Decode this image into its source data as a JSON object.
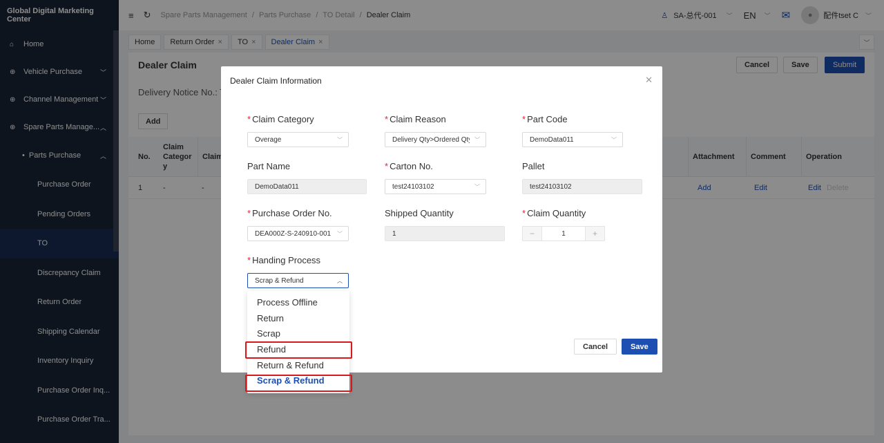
{
  "app": {
    "title": "Global Digital Marketing Center"
  },
  "sidebar": {
    "items": [
      {
        "label": "Home",
        "icon": "home-icon"
      },
      {
        "label": "Vehicle Purchase",
        "icon": "circle-plus-icon"
      },
      {
        "label": "Channel Management",
        "icon": "circle-plus-icon"
      },
      {
        "label": "Spare Parts Manage...",
        "icon": "circle-plus-icon"
      }
    ],
    "sub_parent": "Parts Purchase",
    "sub_items": [
      "Purchase Order",
      "Pending Orders",
      "TO",
      "Discrepancy Claim",
      "Return Order",
      "Shipping Calendar",
      "Inventory Inquiry",
      "Purchase Order Inq...",
      "Purchase Order Tra..."
    ],
    "active_sub": "TO"
  },
  "topbar": {
    "breadcrumb": [
      "Spare Parts Management",
      "/",
      "Parts Purchase",
      "/",
      "TO Detail",
      "/",
      "Dealer Claim"
    ],
    "org": "SA-总代-001",
    "lang": "EN",
    "user": "配件tset C"
  },
  "tabs": [
    "Home",
    "Return Order",
    "TO",
    "Dealer Claim"
  ],
  "page": {
    "title": "Dealer Claim",
    "cancel": "Cancel",
    "save": "Save",
    "submit": "Submit",
    "notice": "Delivery Notice No.: T",
    "add": "Add",
    "columns": {
      "no": "No.",
      "claim_category": "Claim Categor y",
      "claim": "Claim",
      "attachment": "Attachment",
      "comment": "Comment",
      "operation": "Operation"
    },
    "row": {
      "no": "1",
      "c1": "-",
      "c2": "-",
      "attachment": "Add",
      "comment": "Edit",
      "op_edit": "Edit",
      "op_delete": "Delete"
    }
  },
  "modal": {
    "title": "Dealer Claim Information",
    "fields": {
      "claim_category": {
        "label": "Claim Category",
        "value": "Overage"
      },
      "claim_reason": {
        "label": "Claim Reason",
        "value": "Delivery Qty>Ordered Qty"
      },
      "part_code": {
        "label": "Part Code",
        "value": "DemoData011"
      },
      "part_name": {
        "label": "Part Name",
        "value": "DemoData011"
      },
      "carton_no": {
        "label": "Carton No.",
        "value": "test24103102"
      },
      "pallet": {
        "label": "Pallet",
        "value": "test24103102"
      },
      "po_no": {
        "label": "Purchase Order No.",
        "value": "DEA000Z-S-240910-001"
      },
      "shipped_qty": {
        "label": "Shipped Quantity",
        "value": "1"
      },
      "claim_qty": {
        "label": "Claim Quantity",
        "value": "1"
      },
      "handing": {
        "label": "Handing Process",
        "value": "Scrap & Refund"
      }
    },
    "options": [
      "Process Offline",
      "Return",
      "Scrap",
      "Refund",
      "Return & Refund",
      "Scrap & Refund"
    ],
    "cancel": "Cancel",
    "save": "Save"
  }
}
